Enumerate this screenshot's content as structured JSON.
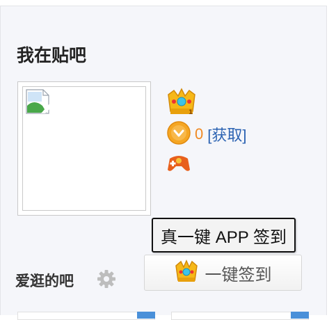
{
  "section": {
    "title": "我在贴吧"
  },
  "user": {
    "coins": "0",
    "get_coins_label": "[获取]"
  },
  "tooltip": {
    "text": "真一键 APP 签到"
  },
  "sign_button": {
    "label": "一键签到"
  },
  "favorites": {
    "title": "爱逛的吧"
  },
  "colors": {
    "coin_count": "#f08a24",
    "link": "#2d64b3",
    "panel_bg": "#f5f6fa",
    "card_accent": "#4a90d9"
  },
  "icons": [
    "broken-image-icon",
    "crown-badge-icon",
    "coin-icon",
    "game-badge-icon",
    "crown-icon",
    "gear-icon"
  ]
}
